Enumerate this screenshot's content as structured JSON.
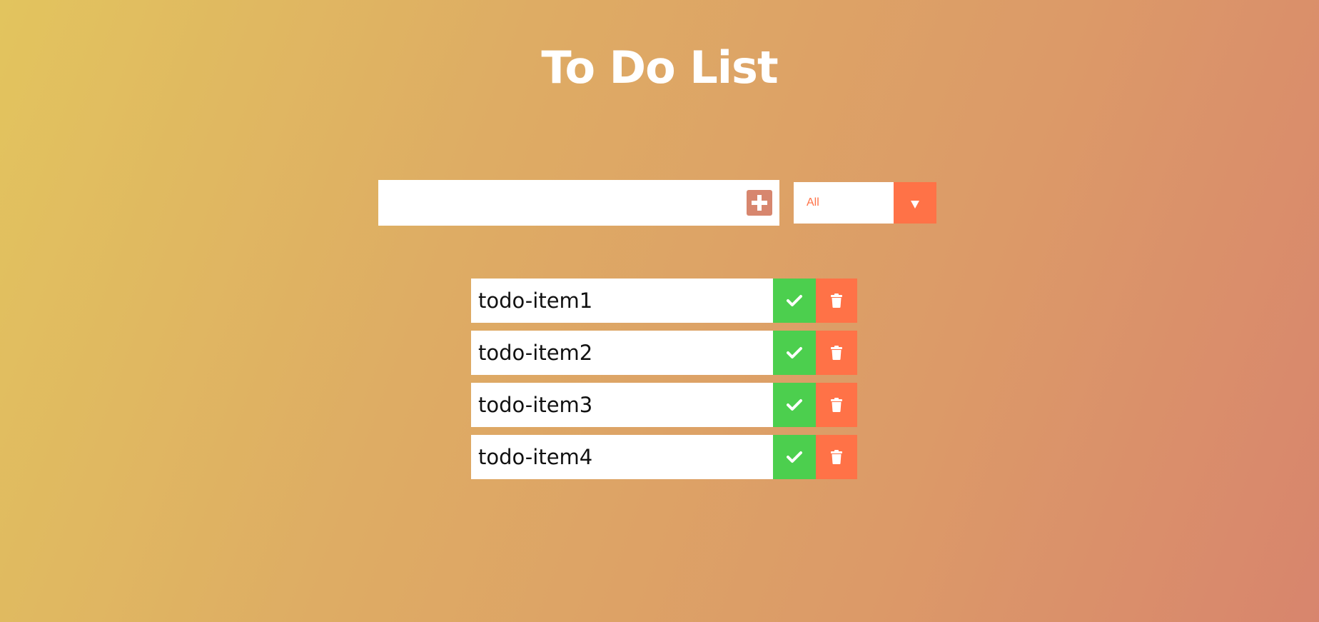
{
  "header": {
    "title": "To Do List"
  },
  "form": {
    "input_value": "",
    "input_placeholder": "",
    "add_icon": "plus-square-icon",
    "filter_selected": "All",
    "filter_arrow_icon": "caret-down-icon"
  },
  "todos": [
    {
      "text": "todo-item1",
      "complete_icon": "check-icon",
      "delete_icon": "trash-icon"
    },
    {
      "text": "todo-item2",
      "complete_icon": "check-icon",
      "delete_icon": "trash-icon"
    },
    {
      "text": "todo-item3",
      "complete_icon": "check-icon",
      "delete_icon": "trash-icon"
    },
    {
      "text": "todo-item4",
      "complete_icon": "check-icon",
      "delete_icon": "trash-icon"
    }
  ],
  "colors": {
    "gradient_start": "#e2c45e",
    "gradient_end": "#d8856d",
    "accent": "#ff7247",
    "complete": "#4ccf4e",
    "add_button": "#d7866e"
  }
}
